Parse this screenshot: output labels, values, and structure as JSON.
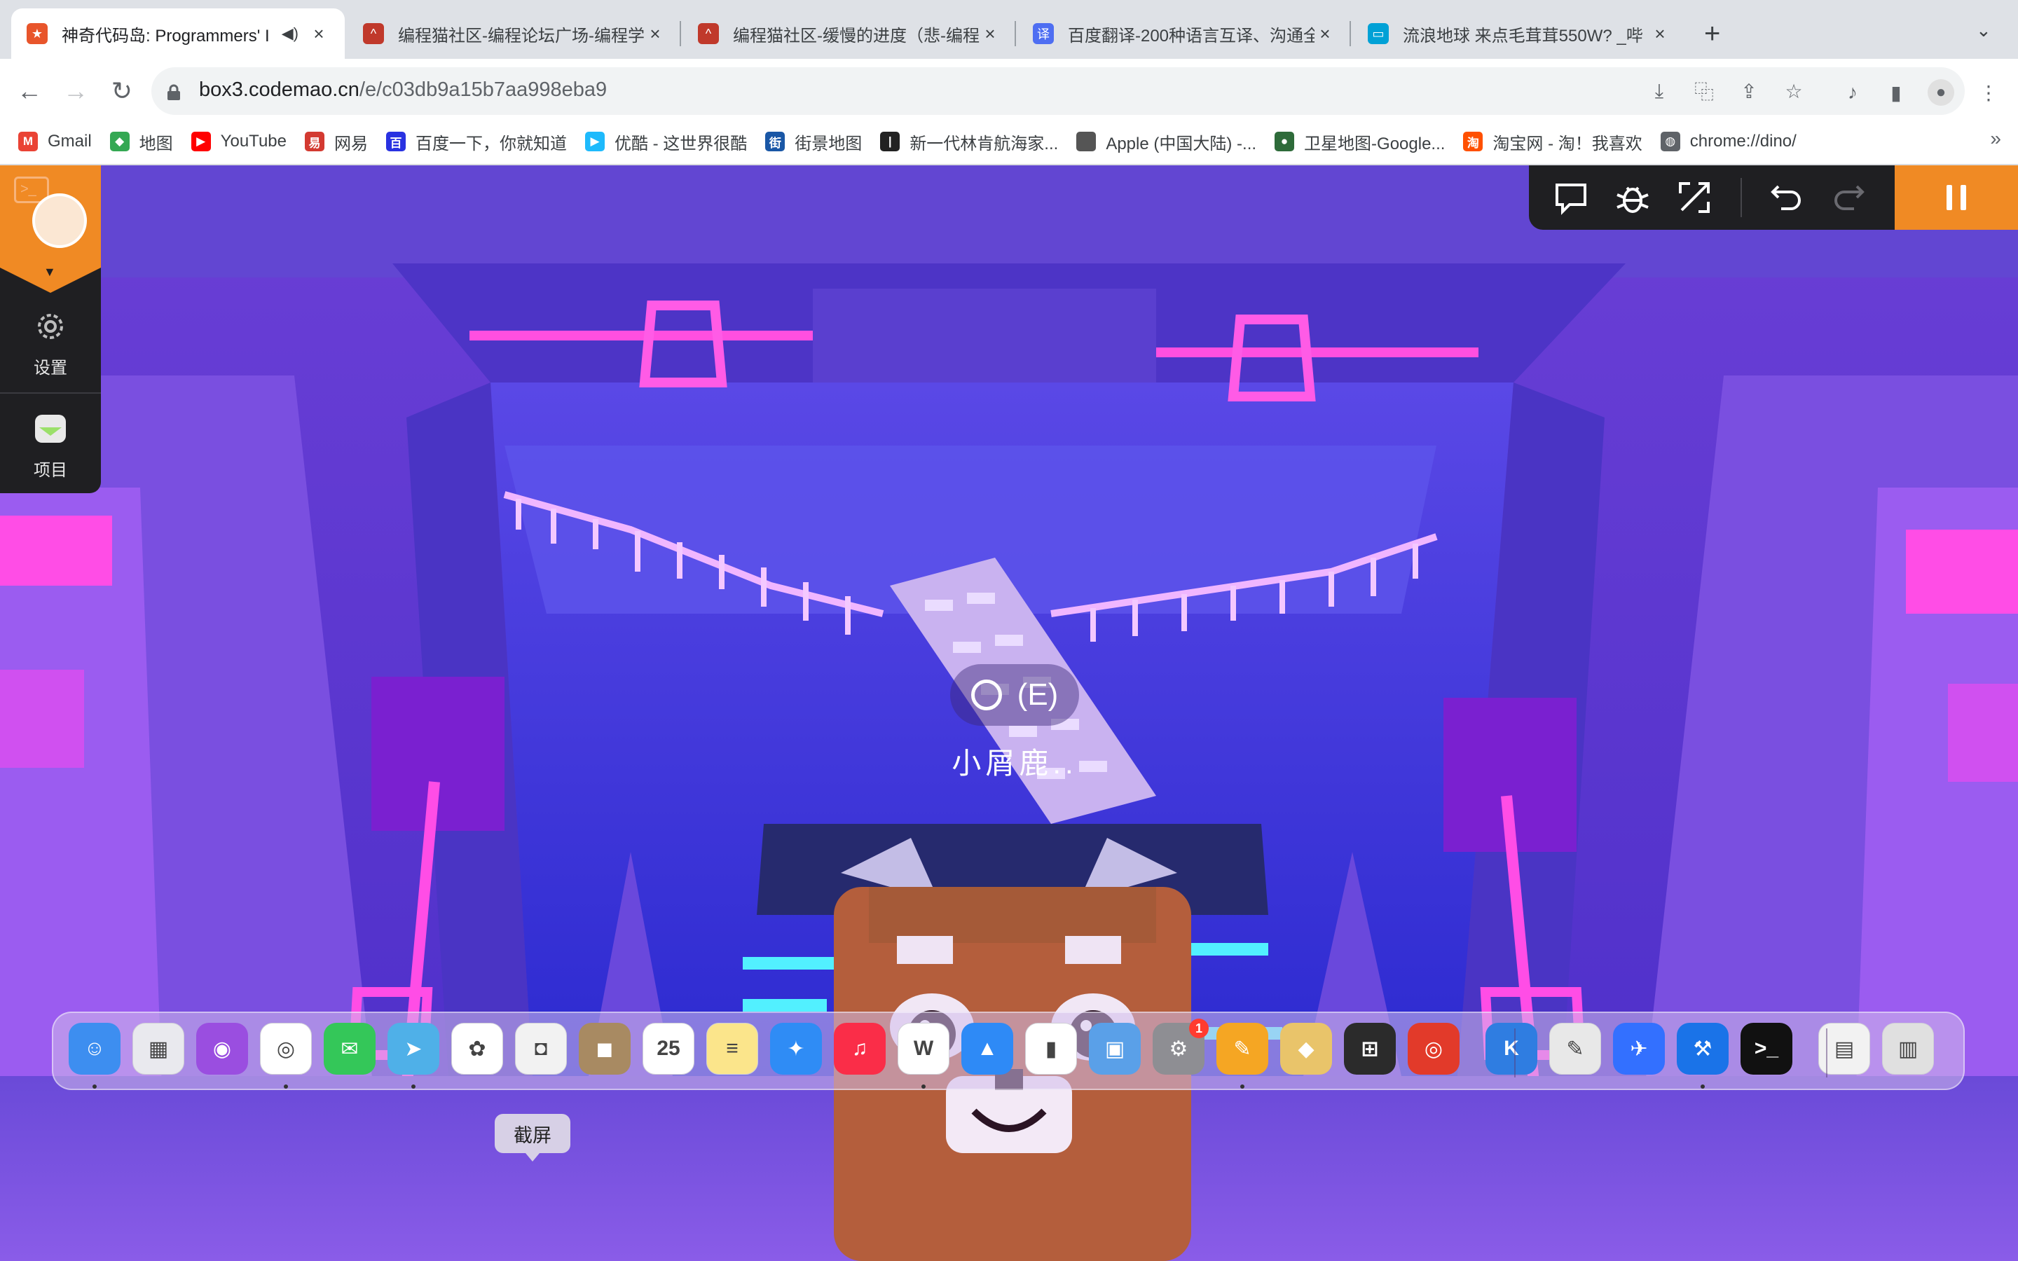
{
  "tabs": [
    {
      "title": "神奇代码岛: Programmers' I",
      "active": true,
      "favicon": "codemao-star-icon",
      "color": "#e8552b"
    },
    {
      "title": "编程猫社区-编程论坛广场-编程学",
      "active": false,
      "favicon": "codemao-cat-icon",
      "color": "#c0392b"
    },
    {
      "title": "编程猫社区-缓慢的进度（悲-编程",
      "active": false,
      "favicon": "codemao-cat-icon",
      "color": "#c0392b"
    },
    {
      "title": "百度翻译-200种语言互译、沟通全",
      "active": false,
      "favicon": "baidu-translate-icon",
      "color": "#4e6ef2"
    },
    {
      "title": "流浪地球 来点毛茸茸550W? _哔",
      "active": false,
      "favicon": "bilibili-icon",
      "color": "#00a1d6"
    }
  ],
  "omnibox": {
    "host": "box3.codemao.cn",
    "path": "/e/c03db9a15b7aa998eba9"
  },
  "bookmarks": [
    {
      "label": "Gmail",
      "icon": "gmail-icon",
      "color": "#ea4335",
      "glyph": "M"
    },
    {
      "label": "地图",
      "icon": "maps-icon",
      "color": "#34a853",
      "glyph": "◆"
    },
    {
      "label": "YouTube",
      "icon": "youtube-icon",
      "color": "#ff0000",
      "glyph": "▶"
    },
    {
      "label": "网易",
      "icon": "netease-icon",
      "color": "#d33a31",
      "glyph": "易"
    },
    {
      "label": "百度一下，你就知道",
      "icon": "baidu-icon",
      "color": "#2932e1",
      "glyph": "百"
    },
    {
      "label": "优酷 - 这世界很酷",
      "icon": "youku-icon",
      "color": "#1ebafc",
      "glyph": "▶"
    },
    {
      "label": "街景地图",
      "icon": "streetview-icon",
      "color": "#1a57a6",
      "glyph": "街"
    },
    {
      "label": "新一代林肯航海家...",
      "icon": "lincoln-icon",
      "color": "#222222",
      "glyph": "|"
    },
    {
      "label": "Apple (中国大陆) -...",
      "icon": "apple-icon",
      "color": "#555555",
      "glyph": ""
    },
    {
      "label": "卫星地图-Google...",
      "icon": "satellite-icon",
      "color": "#2e6b3a",
      "glyph": "●"
    },
    {
      "label": "淘宝网 - 淘！我喜欢",
      "icon": "taobao-icon",
      "color": "#ff5000",
      "glyph": "淘"
    },
    {
      "label": "chrome://dino/",
      "icon": "globe-icon",
      "color": "#5f6368",
      "glyph": "◍"
    }
  ],
  "game": {
    "left_panel": {
      "settings_label": "设置",
      "project_label": "项目"
    },
    "interact": {
      "key_label": "(E)"
    },
    "npc_name": "小屑鹿.."
  },
  "dock": {
    "tooltip": "截屏",
    "apps": [
      {
        "name": "finder",
        "color": "#3d8ef0",
        "glyph": "☺",
        "running": true
      },
      {
        "name": "launchpad",
        "color": "#e9e9ee",
        "glyph": "▦",
        "running": false
      },
      {
        "name": "podcasts",
        "color": "#9a4ee0",
        "glyph": "◉",
        "running": false
      },
      {
        "name": "chrome",
        "color": "#ffffff",
        "glyph": "◎",
        "running": true
      },
      {
        "name": "messages",
        "color": "#34c759",
        "glyph": "✉",
        "running": false
      },
      {
        "name": "maps",
        "color": "#4fb0e8",
        "glyph": "➤",
        "running": true
      },
      {
        "name": "photos",
        "color": "#ffffff",
        "glyph": "✿",
        "running": false
      },
      {
        "name": "screenshot",
        "color": "#f2f2f2",
        "glyph": "◘",
        "running": false
      },
      {
        "name": "contacts",
        "color": "#a88a62",
        "glyph": "◼",
        "running": false
      },
      {
        "name": "calendar",
        "color": "#ffffff",
        "glyph": "25",
        "running": false
      },
      {
        "name": "notes",
        "color": "#fbe58b",
        "glyph": "≡",
        "running": false
      },
      {
        "name": "safari",
        "color": "#2f8cf5",
        "glyph": "✦",
        "running": false
      },
      {
        "name": "music",
        "color": "#fa2d48",
        "glyph": "♫",
        "running": false
      },
      {
        "name": "wps",
        "color": "#ffffff",
        "glyph": "W",
        "running": true
      },
      {
        "name": "keynote",
        "color": "#2e8af6",
        "glyph": "▲",
        "running": false
      },
      {
        "name": "numbers",
        "color": "#ffffff",
        "glyph": "▮",
        "running": false
      },
      {
        "name": "preview",
        "color": "#5aa0e8",
        "glyph": "▣",
        "running": false
      },
      {
        "name": "system-preferences",
        "color": "#8e8e93",
        "glyph": "⚙",
        "running": false,
        "badge": "1"
      },
      {
        "name": "pages",
        "color": "#f5a623",
        "glyph": "✎",
        "running": true
      },
      {
        "name": "sketch",
        "color": "#e9c46a",
        "glyph": "◆",
        "running": false
      },
      {
        "name": "calculator",
        "color": "#2b2b2b",
        "glyph": "⊞",
        "running": false
      },
      {
        "name": "instruments",
        "color": "#e23a2a",
        "glyph": "◎",
        "running": false
      },
      {
        "name": "karabiner",
        "color": "#2f7de1",
        "glyph": "K",
        "running": false
      },
      {
        "name": "script-editor",
        "color": "#e8e8e8",
        "glyph": "✎",
        "running": false
      },
      {
        "name": "feishu",
        "color": "#3370ff",
        "glyph": "✈",
        "running": false
      },
      {
        "name": "xcode",
        "color": "#1a73e8",
        "glyph": "⚒",
        "running": true
      },
      {
        "name": "terminal",
        "color": "#111111",
        "glyph": ">_",
        "running": false
      },
      {
        "name": "document-stack",
        "color": "#f2f2f2",
        "glyph": "▤",
        "running": false
      },
      {
        "name": "trash",
        "color": "#e0e0e0",
        "glyph": "▥",
        "running": false
      }
    ]
  }
}
